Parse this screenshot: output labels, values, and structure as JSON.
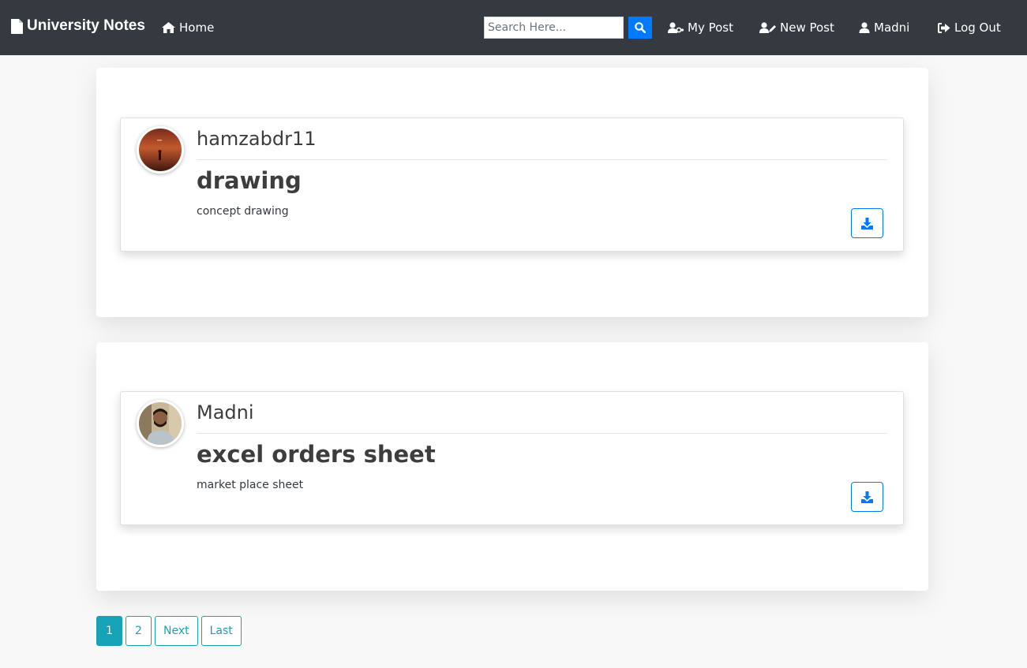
{
  "nav": {
    "brand": "University Notes",
    "home": "Home",
    "search_placeholder": "Search Here...",
    "my_post": "My Post",
    "new_post": "New Post",
    "user": "Madni",
    "logout": "Log Out"
  },
  "posts": [
    {
      "username": "hamzabdr11",
      "title": "drawing",
      "description": "concept drawing",
      "avatar": "sunset-silhouette"
    },
    {
      "username": "Madni",
      "title": "excel orders sheet",
      "description": "market place sheet",
      "avatar": "person-photo"
    }
  ],
  "pagination": {
    "pages": [
      "1",
      "2"
    ],
    "active": "1",
    "next": "Next",
    "last": "Last"
  },
  "colors": {
    "navbar": "#343a40",
    "primary": "#007bff",
    "info": "#17a2b8"
  }
}
